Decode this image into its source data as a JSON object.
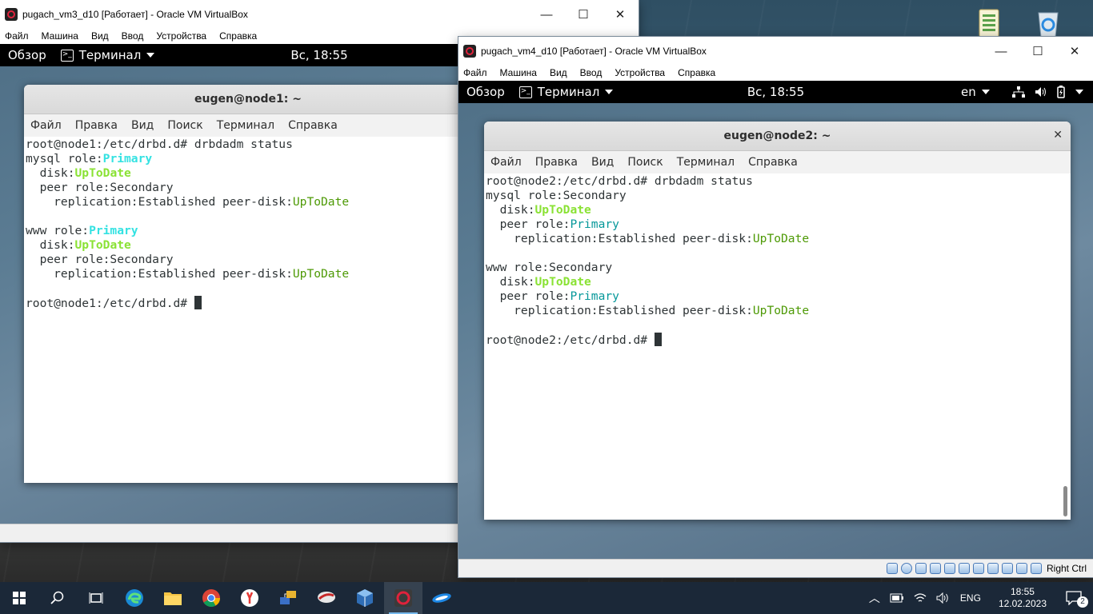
{
  "vm3": {
    "title": "pugach_vm3_d10 [Работает] - Oracle VM VirtualBox",
    "menu": [
      "Файл",
      "Машина",
      "Вид",
      "Ввод",
      "Устройства",
      "Справка"
    ],
    "gnome": {
      "overview": "Обзор",
      "terminal_app": "Терминал",
      "clock": "Вс, 18:55"
    },
    "terminal": {
      "title": "eugen@node1: ~",
      "menu": [
        "Файл",
        "Правка",
        "Вид",
        "Поиск",
        "Терминал",
        "Справка"
      ],
      "lines": [
        [
          {
            "t": "root@node1:/etc/drbd.d# drbdadm status"
          }
        ],
        [
          {
            "t": "mysql role:"
          },
          {
            "t": "Primary",
            "c": "hl-blue"
          }
        ],
        [
          {
            "t": "  disk:"
          },
          {
            "t": "UpToDate",
            "c": "hl-green"
          }
        ],
        [
          {
            "t": "  peer role:Secondary"
          }
        ],
        [
          {
            "t": "    replication:Established peer-disk:"
          },
          {
            "t": "UpToDate",
            "c": "d-green"
          }
        ],
        [
          {
            "t": ""
          }
        ],
        [
          {
            "t": "www role:"
          },
          {
            "t": "Primary",
            "c": "hl-blue"
          }
        ],
        [
          {
            "t": "  disk:"
          },
          {
            "t": "UpToDate",
            "c": "hl-green"
          }
        ],
        [
          {
            "t": "  peer role:Secondary"
          }
        ],
        [
          {
            "t": "    replication:Established peer-disk:"
          },
          {
            "t": "UpToDate",
            "c": "d-green"
          }
        ],
        [
          {
            "t": ""
          }
        ],
        [
          {
            "t": "root@node1:/etc/drbd.d# "
          },
          {
            "cursor": true
          }
        ]
      ]
    }
  },
  "vm4": {
    "title": "pugach_vm4_d10 [Работает] - Oracle VM VirtualBox",
    "menu": [
      "Файл",
      "Машина",
      "Вид",
      "Ввод",
      "Устройства",
      "Справка"
    ],
    "gnome": {
      "overview": "Обзор",
      "terminal_app": "Терминал",
      "clock": "Вс, 18:55",
      "keyboard_layout": "en"
    },
    "terminal": {
      "title": "eugen@node2: ~",
      "close": "✕",
      "menu": [
        "Файл",
        "Правка",
        "Вид",
        "Поиск",
        "Терминал",
        "Справка"
      ],
      "lines": [
        [
          {
            "t": "root@node2:/etc/drbd.d# drbdadm status"
          }
        ],
        [
          {
            "t": "mysql role:Secondary"
          }
        ],
        [
          {
            "t": "  disk:"
          },
          {
            "t": "UpToDate",
            "c": "hl-green"
          }
        ],
        [
          {
            "t": "  peer role:"
          },
          {
            "t": "Primary",
            "c": "d-blue"
          }
        ],
        [
          {
            "t": "    replication:Established peer-disk:"
          },
          {
            "t": "UpToDate",
            "c": "d-green"
          }
        ],
        [
          {
            "t": ""
          }
        ],
        [
          {
            "t": "www role:Secondary"
          }
        ],
        [
          {
            "t": "  disk:"
          },
          {
            "t": "UpToDate",
            "c": "hl-green"
          }
        ],
        [
          {
            "t": "  peer role:"
          },
          {
            "t": "Primary",
            "c": "d-blue"
          }
        ],
        [
          {
            "t": "    replication:Established peer-disk:"
          },
          {
            "t": "UpToDate",
            "c": "d-green"
          }
        ],
        [
          {
            "t": ""
          }
        ],
        [
          {
            "t": "root@node2:/etc/drbd.d# "
          },
          {
            "cursor": true
          }
        ]
      ]
    },
    "status": {
      "host_key": "Right Ctrl"
    }
  },
  "taskbar": {
    "language": "ENG",
    "time": "18:55",
    "date": "12.02.2023",
    "notification_count": "2"
  }
}
